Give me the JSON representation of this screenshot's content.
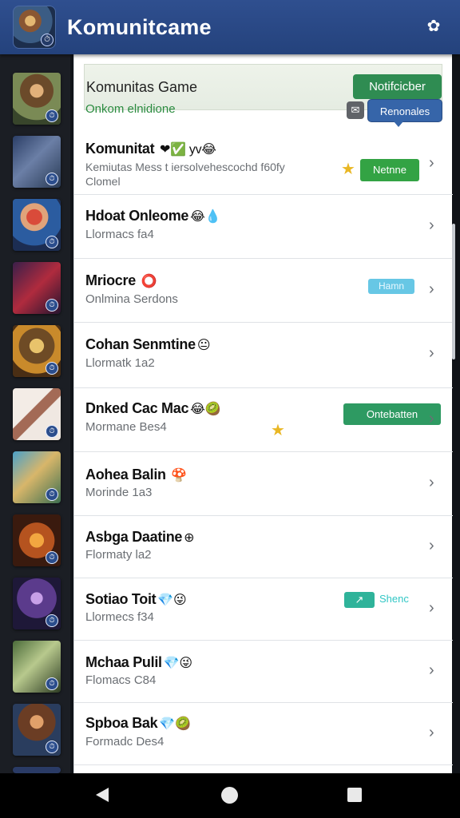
{
  "app": {
    "title": "Komunitcame"
  },
  "panel": {
    "title": "Komunitas Game",
    "notify_label": "Notifcicber",
    "sub_label": "Onkom elnidione",
    "report_label": "Renonales"
  },
  "rows": [
    {
      "name": "Komunitat",
      "emoji": "❤✅ yv😂",
      "sub1": "Kemiutas Mess t iersolvehescochd f60fy",
      "sub2": "Clomel",
      "tag": "Netnne"
    },
    {
      "name": "Hdoat Onleome",
      "emoji": "😂💧",
      "sub1": "Llormacs fa4"
    },
    {
      "name": "Mriocre",
      "emoji": "⭕",
      "sub1": "Onlmina Serdons",
      "tag": "Hamn"
    },
    {
      "name": "Cohan Senmtine",
      "emoji": "😐",
      "sub1": "Llormatk 1a2"
    },
    {
      "name": "Dnked Cac Mac",
      "emoji": "😂🥝",
      "sub1": "Mormane Bes4",
      "tag": "Ontebatten"
    },
    {
      "name": "Aohea Balin",
      "emoji": "🍄",
      "sub1": "Morinde 1a3"
    },
    {
      "name": "Asbga Daatine",
      "emoji": "⊕",
      "sub1": "Flormaty la2"
    },
    {
      "name": "Sotiao Toit",
      "emoji": "💎😜",
      "sub1": "Llormecs f34",
      "tag": "Shenc"
    },
    {
      "name": "Mchaa Pulil",
      "emoji": "💎😜",
      "sub1": "Flomacs C84"
    },
    {
      "name": "Spboa Bak",
      "emoji": "💎🥝",
      "sub1": "Formadc Des4"
    }
  ],
  "colors": {
    "appbar": "#2f4f8f",
    "notify": "#2f8c52",
    "report": "#3665a9",
    "accent_green": "#2a8b3f"
  }
}
